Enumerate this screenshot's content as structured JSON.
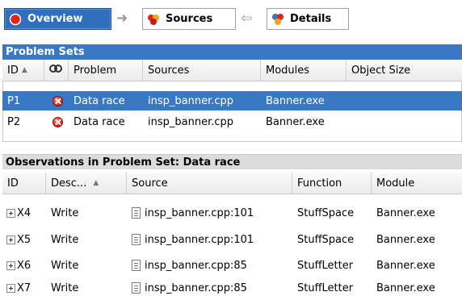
{
  "nav": {
    "overview_label": "Overview",
    "sources_label": "Sources",
    "details_label": "Details",
    "arrow_right": "➜",
    "arrow_left": "⇦"
  },
  "problem_sets": {
    "title": "Problem Sets",
    "columns": [
      "ID",
      "Problem",
      "Sources",
      "Modules",
      "Object Size"
    ],
    "rows": [
      {
        "id": "P1",
        "problem": "Data race",
        "sources": "insp_banner.cpp",
        "modules": "Banner.exe",
        "object_size": ""
      },
      {
        "id": "P2",
        "problem": "Data race",
        "sources": "insp_banner.cpp",
        "modules": "Banner.exe",
        "object_size": ""
      }
    ]
  },
  "observations": {
    "title": "Observations in Problem Set: Data race",
    "columns": [
      "ID",
      "Desc...",
      "Source",
      "Function",
      "Module"
    ],
    "rows": [
      {
        "id": "X4",
        "desc": "Write",
        "source": "insp_banner.cpp:101",
        "function": "StuffSpace",
        "module": "Banner.exe"
      },
      {
        "id": "X5",
        "desc": "Write",
        "source": "insp_banner.cpp:101",
        "function": "StuffSpace",
        "module": "Banner.exe"
      },
      {
        "id": "X6",
        "desc": "Write",
        "source": "insp_banner.cpp:85",
        "function": "StuffLetter",
        "module": "Banner.exe"
      },
      {
        "id": "X7",
        "desc": "Write",
        "source": "insp_banner.cpp:85",
        "function": "StuffLetter",
        "module": "Banner.exe"
      }
    ]
  },
  "colors": {
    "accent": "#3a78c4",
    "error": "#d8281a"
  }
}
